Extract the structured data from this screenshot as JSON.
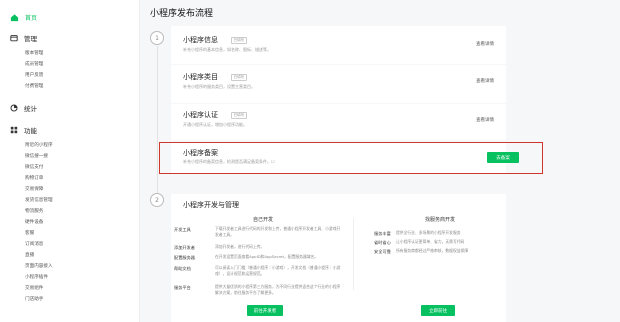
{
  "sidebar": {
    "home": "首页",
    "sections": [
      {
        "label": "管理",
        "items": [
          "版本管理",
          "成员管理",
          "用户反馈",
          "付费管理"
        ]
      },
      {
        "label": "统计",
        "items": []
      },
      {
        "label": "功能",
        "items": [
          "附近的小程序",
          "微信搜一搜",
          "微信支付",
          "购物订单",
          "交易保障",
          "发货信息管理",
          "物流服务",
          "硬件设备",
          "客服",
          "订阅消息",
          "直播",
          "页面内容接入",
          "小程序插件",
          "交易组件",
          "门店助手"
        ]
      }
    ]
  },
  "main": {
    "title": "小程序发布流程",
    "step1": "1",
    "step2": "2",
    "cards": [
      {
        "title": "小程序信息",
        "badge": "已填写",
        "desc": "补充小程序的基本信息，如名称、图标、描述等。",
        "link": "查看详情"
      },
      {
        "title": "小程序类目",
        "badge": "已填写",
        "desc": "补充小程序的服务类目，设置主营类目。",
        "link": "查看详情"
      },
      {
        "title": "小程序认证",
        "badge": "已填写",
        "desc": "开通小程序认证，增加小程序功能。",
        "link": "查看详情"
      },
      {
        "title": "小程序备案",
        "desc": "补充小程序的备案信息，检测是否满足备案条件。☐",
        "button": "去备案"
      }
    ],
    "dev": {
      "title": "小程序开发与管理",
      "self_title": "自己开发",
      "self_rows": [
        {
          "label": "开发工具",
          "text": "下载开发者工具进行代码的开发和上传，普通小程序开发者工具、小游戏开发者工具。"
        },
        {
          "label": "添加开发者",
          "text": "添加开发者，进行代码上传。"
        },
        {
          "label": "配置服务器",
          "text": "在开发设置页面查看AppID和AppSecret，配置服务器域名。"
        },
        {
          "label": "帮助文档",
          "text": "可以阅读入门门槛（普通小程序｜小游戏），开发文档（普通小程序｜小游戏），设计规范和运营规范。"
        },
        {
          "label": "服务平台",
          "text": "提供大量优质的小程序第三方服务，为不同行业提供适合这个行业的小程序解决方案，前往服务平台了解更多。"
        }
      ],
      "self_button": "前往开发者",
      "vendor_title": "找服务商开发",
      "vendor_rows": [
        {
          "label": "服务丰富",
          "text": "提供全行业、多场景的小程序开发服务"
        },
        {
          "label": "省时省心",
          "text": "让小程序认证更简单、省力，无需写代码"
        },
        {
          "label": "安全可靠",
          "text": "所有服务商都经过严格审核，数据权益保障"
        }
      ],
      "vendor_button": "立即前往"
    }
  }
}
